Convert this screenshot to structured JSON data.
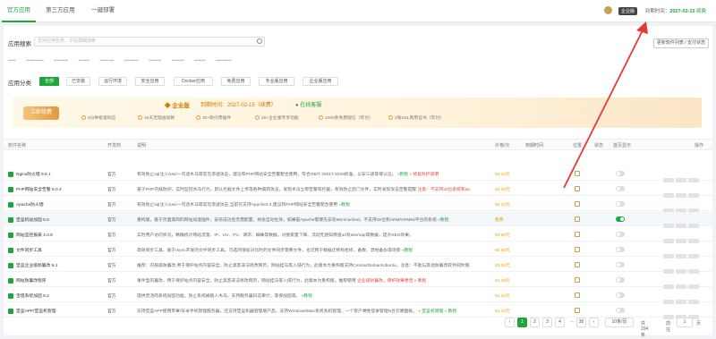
{
  "tabs": [
    {
      "label": "官方应用",
      "active": true
    },
    {
      "label": "第三方应用",
      "active": false
    },
    {
      "label": "一键部署",
      "active": false
    }
  ],
  "header": {
    "vip_label": "企业版",
    "expire_label": "到期时间：",
    "expire_date": "2027-02-15",
    "renew": "续费"
  },
  "search": {
    "label": "应用搜索",
    "placeholder": "支持应用名称、字段模糊搜索",
    "refresh_button": "更新软件列表 / 支付状态"
  },
  "category": {
    "label": "应用分类",
    "items": [
      {
        "label": "全部",
        "active": true
      },
      {
        "label": "已安装",
        "active": false
      },
      {
        "label": "运行环境",
        "active": false
      },
      {
        "label": "安全应用",
        "active": false
      },
      {
        "label": "Docker应用",
        "active": false
      },
      {
        "label": "免费应用",
        "active": false
      },
      {
        "label": "专业版应用",
        "active": false
      },
      {
        "label": "企业版应用",
        "active": false
      }
    ]
  },
  "banner": {
    "badge": "立即续费",
    "title": "企业版",
    "expire": "到期时间：2027-02-15（续费）",
    "online": "在线客服",
    "features": [
      "5分钟极速响应",
      "15天无理由退款",
      "30+款付费插件",
      "20+企业版专享功能",
      "1000条免费短信（年付）",
      "2张SSL商用证书（年付）"
    ]
  },
  "table": {
    "headers": [
      "软件名称",
      "开发商",
      "说明",
      "价格/元",
      "到期时间",
      "位置",
      "状态",
      "首页显示",
      "操作"
    ],
    "rows": [
      {
        "name": "Nginx防火墙 9.6.1",
        "dev": "官方",
        "desc": "有效防止sql注入/xss/一句话木马等常见渗透攻击，建议和PHP网站安全告警配合使用，符合GB/T 32917-2016标准，公安三级等保认证，",
        "link": "»教程",
        "extra": "» 修复防护说明",
        "price": "¥2.33元",
        "expire": "",
        "toggle": false
      },
      {
        "name": "PHP网站安全告警 8.0.4",
        "dev": "官方",
        "desc": "基于PHP内核防护，实时监控木马行为，默认拦截文件上传等各种漏洞攻击，发现木马立即告警或拦截，有效防止后门文件，实时发现攻击告警提醒",
        "link": "",
        "extra": "注意：不支持32位系统和arm平台和PHP5.2 » 教程",
        "price": "¥2.00元",
        "expire": "",
        "toggle": false
      },
      {
        "name": "Apache防火墙",
        "dev": "官方",
        "desc": "有效防止sql注入/xss/一句话木马等常见渗透攻击,当前仅支持Apache2.4,建议和PHP网站安全告警配合使用",
        "link": "»教程",
        "extra": "",
        "price": "¥2.33元",
        "expire": "",
        "toggle": false
      },
      {
        "name": "堡垒机站加固 5.0",
        "dev": "官方",
        "desc": "重构版，基于页面漏洞的网站加速插件，安装成功后无需配置，将会自动生效，如果是Apache需要先安装Memcached，不支持32位和ARM/ARM64平台的系统",
        "link": "»教程",
        "extra": "",
        "price": "免费",
        "expire": "",
        "toggle": true
      },
      {
        "name": "网站监控报表 4.0.5",
        "dev": "官方",
        "desc": "实时用户访问状况，精确统计网站流量、IP、UV、PV、请求、蜘蛛等数据，对搜索量下降、流动无感知频道url及sitemap等数据，提升SEO效果。",
        "link": "",
        "extra": "",
        "price": "¥0.99元",
        "expire": "",
        "toggle": false
      },
      {
        "name": "文件同步工具",
        "dev": "官方",
        "desc": "高效同步工具，基于rsync开发的文件同步工具，可选的增加对比时的文件同步需要文件，也可用于数据迁移和抢修，备数、异地备份等场景",
        "link": "»教程",
        "extra": "",
        "price": "¥0.66元",
        "expire": "",
        "toggle": false
      },
      {
        "name": "堡垒企业级防篡改 6.1",
        "dev": "官方",
        "desc": "推荐：内核级防篡改,用于保护站点内容安全，防止黑客非法修改网页，网站挂马等入侵行为，此版本为重构版支持Centos/Debian/Ubuntu，注意：不能与其他防篡改软件同时使用",
        "link": "»教程",
        "extra": "",
        "price": "¥3.00元",
        "expire": "",
        "toggle": false
      },
      {
        "name": "网站防篡改程序",
        "dev": "官方",
        "desc": "事件型的篡改，用于保护站点内容安全，防止黑客非法修改网页，网站挂马等入侵行为，此版本为重构版。推荐使用",
        "link": "",
        "extra": "企业级防篡改，保护效果更佳 » 教程",
        "price": "¥1.33元",
        "expire": "",
        "toggle": false
      },
      {
        "name": "宝塔系统加固 6.2",
        "dev": "官方",
        "desc": "提供灵活的系统加固功能，防止系统被植入木马，支持服务器日志审计，等保加固等。",
        "link": "»教程",
        "extra": "",
        "price": "¥1.33元",
        "expire": "",
        "toggle": false
      },
      {
        "name": "堡垒APP/堡垒机管理",
        "dev": "官方",
        "desc": "支持堡垒APP使用苹果/安卓手机管理服务器，还支持堡垒机器管理版产品，支持Windows/Mac系统多机管理，一个客户端免登录管理N台云端面板。",
        "link": "» 堡垒机管理 » 教程",
        "extra": "",
        "price": "¥1.33元",
        "expire": "",
        "toggle": false
      }
    ]
  },
  "pager": {
    "prev": "‹",
    "pages": [
      "1",
      "2",
      "3",
      "4",
      "…",
      "30"
    ],
    "next": "›",
    "per_page": "10条/页",
    "total": "共 294 条",
    "goto_label": "前往",
    "goto_value": "1",
    "goto_suffix": "页"
  }
}
